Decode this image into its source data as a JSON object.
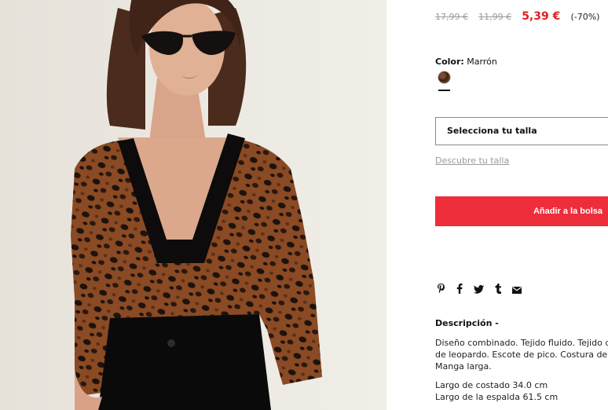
{
  "product": {
    "old_price_1": "17,99 €",
    "old_price_2": "11,99 €",
    "current_price": "5,39 €",
    "discount": "(-70%)",
    "color_label": "Color:",
    "color_value": "Marrón",
    "size_placeholder": "Selecciona tu talla",
    "size_guide_link": "Descubre tu talla",
    "add_to_bag": "Añadir a la bolsa",
    "description_title": "Descripción -",
    "description_lines": [
      "Diseño combinado. Tejido fluido. Tejido de",
      "de leopardo. Escote de pico. Costura del h",
      "Manga larga."
    ],
    "measure_lines": [
      "Largo de costado 34.0 cm",
      "Largo de la espalda 61.5 cm"
    ]
  },
  "share_icons": [
    "pinterest-icon",
    "facebook-icon",
    "twitter-icon",
    "tumblr-icon",
    "mail-icon"
  ],
  "colors": {
    "accent": "#ee2d3b",
    "price_red": "#e02020",
    "muted": "#9a9a9a"
  }
}
